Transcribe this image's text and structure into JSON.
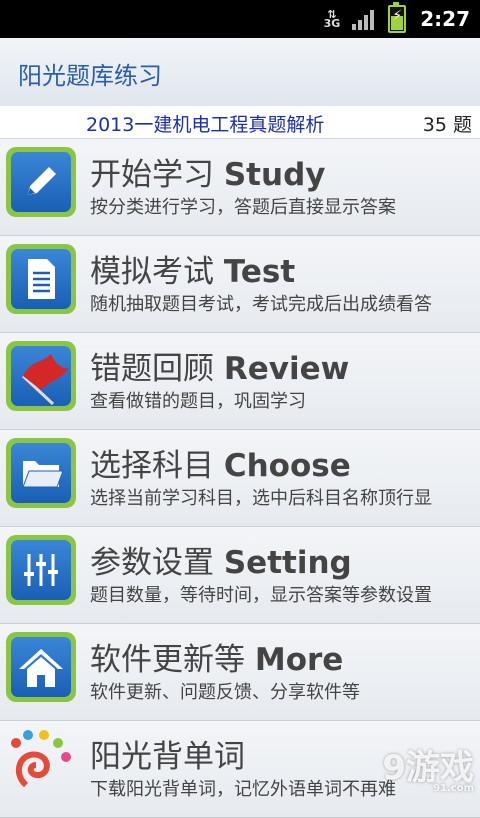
{
  "status_bar": {
    "network": "3G",
    "time": "2:27"
  },
  "app": {
    "title": "阳光题库练习"
  },
  "exam": {
    "name": "2013一建机电工程真题解析",
    "count": "35 题"
  },
  "menu": [
    {
      "zh": "开始学习 ",
      "en": "Study",
      "desc": "按分类进行学习，答题后直接显示答案",
      "icon": "pencil-icon"
    },
    {
      "zh": "模拟考试 ",
      "en": "Test",
      "desc": "随机抽取题目考试，考试完成后出成绩看答",
      "icon": "document-icon"
    },
    {
      "zh": "错题回顾 ",
      "en": "Review",
      "desc": "查看做错的题目，巩固学习",
      "icon": "red-flag-icon"
    },
    {
      "zh": "选择科目 ",
      "en": "Choose",
      "desc": "选择当前学习科目，选中后科目名称顶行显",
      "icon": "folder-icon"
    },
    {
      "zh": "参数设置 ",
      "en": "Setting",
      "desc": "题目数量，等待时间，显示答案等参数设置",
      "icon": "sliders-icon"
    },
    {
      "zh": "软件更新等 ",
      "en": "More",
      "desc": "软件更新、问题反馈、分享软件等",
      "icon": "home-icon"
    },
    {
      "zh": "阳光背单词",
      "en": "",
      "desc": "下载阳光背单词，记忆外语单词不再难",
      "icon": "sun-logo-icon"
    }
  ],
  "watermark": {
    "text": "9游戏",
    "sub": "91.com"
  }
}
